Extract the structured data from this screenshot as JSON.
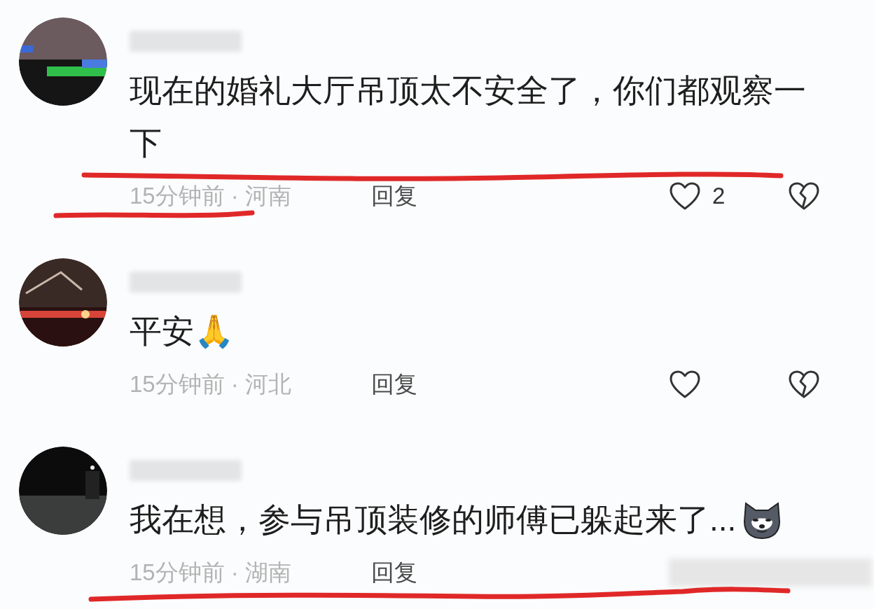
{
  "comments": [
    {
      "text": "现在的婚礼大厅吊顶太不安全了，你们都观察一下",
      "meta": "15分钟前 · 河南",
      "reply": "回复",
      "likes": "2",
      "trailing_sticker": false,
      "actions_obscured": false
    },
    {
      "text": "平安🙏",
      "meta": "15分钟前 · 河北",
      "reply": "回复",
      "trailing_sticker": false,
      "actions_obscured": false
    },
    {
      "text": "我在想，参与吊顶装修的师傅已躲起来了...",
      "meta": "15分钟前 · 湖南",
      "reply": "回复",
      "trailing_sticker": true,
      "actions_obscured": true
    }
  ]
}
